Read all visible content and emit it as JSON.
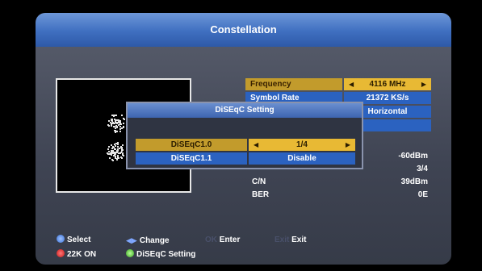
{
  "window": {
    "title": "Constellation"
  },
  "info": {
    "frequency": {
      "label": "Frequency",
      "value": "4116 MHz"
    },
    "symbol_rate": {
      "label": "Symbol Rate",
      "value": "21372 KS/s"
    },
    "polarity_value": "Horizontal"
  },
  "stats": [
    {
      "label": "",
      "value": "-60dBm"
    },
    {
      "label": "",
      "value": "3/4"
    },
    {
      "label": "C/N",
      "value": "39dBm"
    },
    {
      "label": "BER",
      "value": "0E"
    }
  ],
  "dialog": {
    "title": "DiSEqC Setting",
    "items": [
      {
        "label": "DiSEqC1.0",
        "value": "1/4"
      },
      {
        "label": "DiSEqC1.1",
        "value": "Disable"
      }
    ]
  },
  "help": {
    "select": "Select",
    "change": "Change",
    "ok_key": "OK",
    "enter": "Enter",
    "exit_key": "Exit",
    "exit": "Exit",
    "red": "22K ON",
    "green": "DiSEqC Setting"
  },
  "colors": {
    "title_bar": "#3f6fc0",
    "selected_row": "#e8b934",
    "row_highlight": "#2b62c0"
  },
  "icons": {
    "left_arrow": "left-triangle-icon",
    "right_arrow": "right-triangle-icon",
    "red_key": "red-button-icon",
    "green_key": "green-button-icon"
  }
}
